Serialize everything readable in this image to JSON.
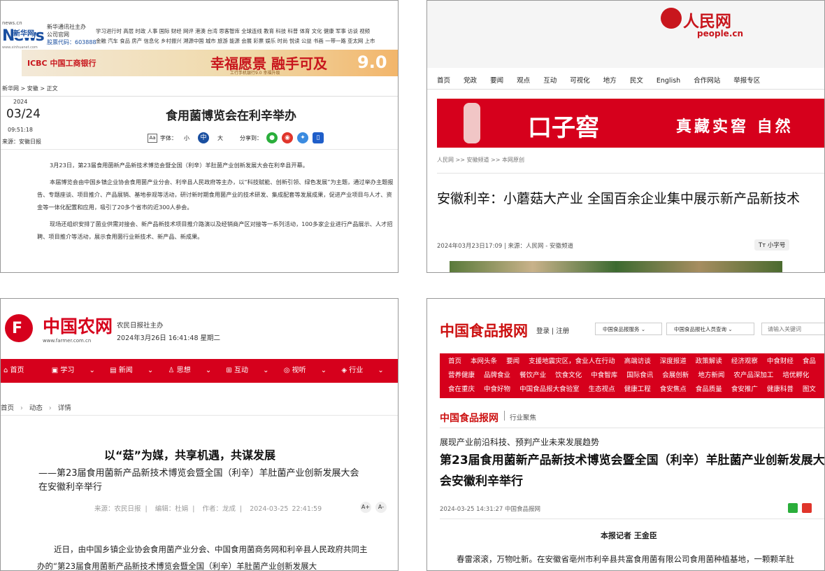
{
  "panel1": {
    "logo": {
      "site": "news.cn",
      "name": "新华网",
      "mark": "News",
      "sub": "www.xinhuanet.com"
    },
    "org_lines": [
      "新华通讯社主办",
      "公司官网",
      "股票代码：603888"
    ],
    "nav_row1": "学习进行时 高层 时政 人事 国际 财经 网评 港澳 台湾 思客智库 全球连线 教育 科技 科普 体育 文化 健康 军事 访谈 视频",
    "nav_row2": "金融 汽车 食品 房产 信息化 乡村振兴 溯源中国 城市 旅游 能源 会展 彩票 娱乐 时尚 悦读 公益 书画 一带一路 亚太网 上市",
    "ad": {
      "bank": "ICBC 中国工商银行",
      "slogan": "幸福愿景 融手可及",
      "sub": "工行手机银行9.0 幸福升级",
      "badge": "9.0"
    },
    "breadcrumb": "新华网 > 安徽 > 正文",
    "date": {
      "year": "2024",
      "md": "03/24",
      "time": "09:51:18",
      "source": "来源：安徽日报"
    },
    "title": "食用菌博览会在利辛举办",
    "font_label": "字体：",
    "font_sizes": [
      "小",
      "中",
      "大"
    ],
    "share_label": "分享到：",
    "paragraphs": [
      "3月23日，第23届食用菌新产品新技术博览会暨全国（利辛）羊肚菌产业创新发展大会在利辛县开幕。",
      "本届博览会由中国乡镇企业协会食用菌产业分会、利辛县人民政府等主办，以“科技赋能、创新引领、绿色发展”为主题，通过举办主题报告、专题座谈、项目推介、产品展销、基地参观等活动，研讨新时期食用菌产业的技术研发、集成配套等发展成果，促进产业项目与人才、资金等一体化配置和应用，吸引了20多个省市的近300人参会。",
      "现场还组织安排了菌业供需对接会、新产品新技术项目推介路演以及经销商产区对接等一系列活动，100多家企业进行产品展示、人才招聘、项目推介等活动，展示食用菌行业新技术、新产品、新成果。"
    ]
  },
  "panel2": {
    "logo": {
      "cn": "人民网",
      "en": "people.cn"
    },
    "nav": [
      "首页",
      "党政",
      "要闻",
      "观点",
      "互动",
      "可视化",
      "地方",
      "民文",
      "English",
      "合作网站",
      "举报专区"
    ],
    "ad": {
      "brand": "口子窖",
      "slogan": "真藏实窖 自然"
    },
    "breadcrumb": "人民网 >> 安徽频道 >> 本网原创",
    "title": "安徽利辛：小蘑菇大产业 全国百余企业集中展示新产品新技术",
    "meta": "2024年03月23日17:09 | 来源：人民网 - 安徽频道",
    "font_btn": "小字号"
  },
  "panel3": {
    "logo": {
      "cn": "中国农网",
      "en": "www.farmer.com.cn"
    },
    "org": "农民日报社主办",
    "datetime": "2024年3月26日 16:41:48 星期二",
    "nav": [
      "首页",
      "学习",
      "新闻",
      "思想",
      "互动",
      "视听",
      "行业"
    ],
    "breadcrumb": [
      "首页",
      "动态",
      "详情"
    ],
    "title": "以“菇”为媒，共享机遇，共谋发展",
    "subtitle": "——第23届食用菌新产品新技术博览会暨全国（利辛）羊肚菌产业创新发展大会在安徽利辛举行",
    "meta": [
      "来源：农民日报",
      "编辑：杜娟",
      "作者：龙成",
      "2024-03-25 22:41:59"
    ],
    "font_btns": [
      "A+",
      "A-"
    ],
    "body": "近日，由中国乡镇企业协会食用菌产业分会、中国食用菌商务网和利辛县人民政府共同主办的“第23届食用菌新产品新技术博览会暨全国（利辛）羊肚菌产业创新发展大"
  },
  "panel4": {
    "logo": "中国食品报网",
    "login": "登录 | 注册",
    "select1": "中国食品报服务",
    "select2": "中国食品报社人员查询",
    "search_placeholder": "请输入关键词",
    "nav_row1": [
      "首页",
      "本网头条",
      "要闻",
      "支援地震灾区，食业人在行动",
      "高端访谈",
      "深度报道",
      "政策解读",
      "经济观察",
      "中食财经",
      "食品"
    ],
    "nav_row2": [
      "营养健康",
      "品牌食业",
      "餐饮产业",
      "饮食文化",
      "中食智库",
      "国际食讯",
      "会展创新",
      "地方新闻",
      "农产品深加工",
      "培优孵化"
    ],
    "nav_row3": [
      "食在重庆",
      "中食好物",
      "中国食品报大食验室",
      "生态视点",
      "健康工程",
      "食安焦点",
      "食品质量",
      "食安推广",
      "健康科普",
      "图文"
    ],
    "section": "行业聚焦",
    "kicker": "展现产业前沿科技、预判产业未来发展趋势",
    "title": "第23届食用菌新产品新技术博览会暨全国（利辛）羊肚菌产业创新发展大会安徽利辛举行",
    "meta": "2024-03-25 14:31:27 中国食品报网",
    "reporter": "本报记者 王金臣",
    "body": "春雷滚滚，万物吐新。在安徽省亳州市利辛县共富食用菌有限公司食用菌种植基地，一颗颗羊肚"
  },
  "colors": {
    "xinhua_blue": "#1a4fa0",
    "people_red": "#c8161d",
    "farmer_red": "#d6001c",
    "food_red": "#cc1010"
  }
}
